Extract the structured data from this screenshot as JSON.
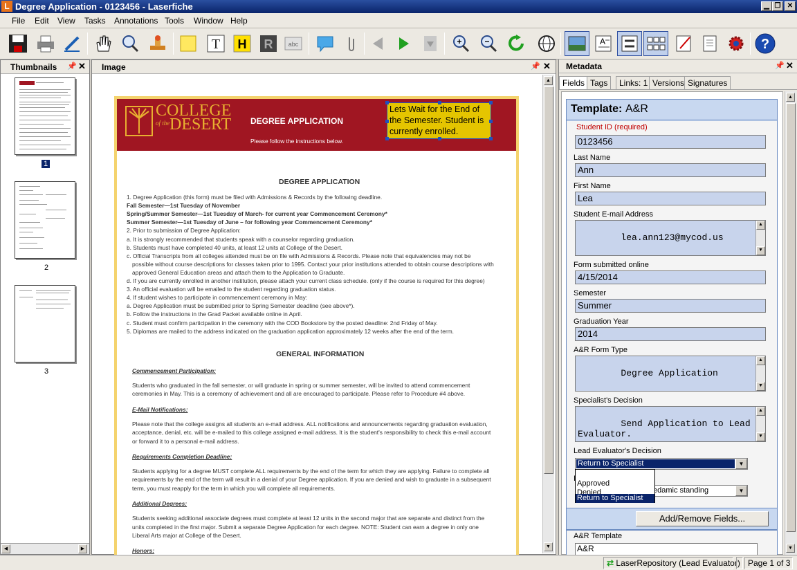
{
  "window": {
    "title": "Degree Application - 0123456 - Laserfiche",
    "app_icon_letter": "L"
  },
  "menu": [
    "File",
    "Edit",
    "View",
    "Tasks",
    "Annotations",
    "Tools",
    "Window",
    "Help"
  ],
  "toolbar": {
    "icons": [
      "save-icon",
      "print-icon",
      "pen-icon",
      "hand-icon",
      "zoom-select-icon",
      "stamp-icon",
      "sticky-note-icon",
      "text-icon",
      "highlight-icon",
      "redact-icon",
      "ocr-text-icon",
      "comment-icon",
      "attachment-icon",
      "previous-page-icon",
      "next-page-icon",
      "page-down-icon",
      "zoom-in-icon",
      "zoom-out-icon",
      "refresh-icon",
      "globe-icon",
      "image-view-icon",
      "text-view-icon",
      "metadata-view-icon",
      "thumbnail-view-icon",
      "edit-document-icon",
      "document-icon",
      "settings-icon",
      "help-icon"
    ],
    "text_tool_glyph": "T",
    "highlight_glyph": "H",
    "redact_glyph": "R",
    "ocr_glyph": "abc"
  },
  "thumbnails": {
    "title": "Thumbnails",
    "pages": [
      "1",
      "2",
      "3"
    ],
    "selected": "1"
  },
  "image_pane": {
    "title": "Image"
  },
  "document": {
    "college_name_line1": "COLLEGE",
    "college_name_line2": "of the",
    "college_name_line3": "DESERT",
    "header_title": "DEGREE APPLICATION",
    "header_subtitle": "Please follow the instructions below.",
    "heading1": "DEGREE APPLICATION",
    "items": [
      "1. Degree Application (this form) must be filed with Admissions & Records by the following deadline.",
      "Fall Semester—1st Tuesday of November",
      "Spring/Summer Semester—1st Tuesday of March- for current year Commencement Ceremony*",
      "Summer Semester—1st Tuesday of June – for following year Commencement Ceremony*",
      "2. Prior to submission of Degree Application:",
      "a. It is strongly recommended that students speak with a counselor regarding graduation.",
      "b. Students must have completed 40 units, at least 12 units at College of the Desert.",
      "c. Official Transcripts from all colleges attended must be on file with Admissions & Records. Please note that equivalencies may not be",
      "possible without course descriptions for classes taken prior to 1995. Contact your prior institutions attended to obtain course descriptions with",
      "approved General Education areas and attach them to the Application to Graduate.",
      "d. If you are currently enrolled in another institution, please attach your current class schedule. (only if the course is required for this degree)",
      "3. An official evaluation will be emailed to the student regarding graduation status.",
      "4. If student wishes to participate in commencement ceremony in May:",
      "a. Degree Application must be submitted prior to Spring Semester deadline (see above*).",
      "b. Follow the instructions in the Grad Packet available online in April.",
      "c. Student must confirm participation in the ceremony with the COD Bookstore by the posted deadline: 2nd Friday of May.",
      "5. Diplomas are mailed to the address indicated on the graduation application approximately 12 weeks after the end of the term."
    ],
    "heading2": "GENERAL INFORMATION",
    "sections": [
      {
        "title": "Commencement Participation:",
        "lines": [
          "Students who graduated in the fall semester, or will graduate in spring or summer semester, will be invited to attend commencement",
          "ceremonies in May. This is a ceremony of achievement and all are encouraged to participate. Please refer to Procedure #4 above."
        ]
      },
      {
        "title": "E-Mail Notifications:",
        "lines": [
          "Please note that the college assigns all students an e-mail address. ALL notifications and announcements regarding graduation evaluation,",
          "acceptance, denial, etc. will be e-mailed to this college assigned e-mail address. It is the student's responsibility to check this e-mail account",
          "or forward it to a personal e-mail address."
        ]
      },
      {
        "title": "Requirements Completion Deadline:",
        "lines": [
          "Students applying for a degree MUST complete ALL requirements by the end of the term for which they are applying. Failure to complete all",
          "requirements by the end of the term will result in a denial of your Degree application. If you are denied and wish to graduate in a subsequent",
          "term, you must reapply for the term in which you will complete all requirements."
        ]
      },
      {
        "title": "Additional Degrees:",
        "lines": [
          "Students seeking additional associate degrees must complete at least 12 units in the second major that are separate and distinct from the",
          "units completed in the first major. Submit a separate Degree Application for each degree. NOTE: Student can earn a degree in only one",
          "Liberal Arts major at College of the Desert."
        ]
      },
      {
        "title": "Honors:",
        "lines": []
      }
    ],
    "annotation": "Lets Wait for the End of the Semester. Student is currently enrolled."
  },
  "metadata": {
    "title": "Metadata",
    "tabs": [
      "Fields",
      "Tags",
      "Links: 1",
      "Versions",
      "Signatures"
    ],
    "template_label": "Template:",
    "template_name": "A&R",
    "fields": {
      "student_id_label": "Student ID (required)",
      "student_id": "0123456",
      "last_name_label": "Last Name",
      "last_name": "Ann",
      "first_name_label": "First Name",
      "first_name": "Lea",
      "email_label": "Student E-mail Address",
      "email": "lea.ann123@mycod.us",
      "submitted_label": "Form submitted online",
      "submitted": "4/15/2014",
      "semester_label": "Semester",
      "semester": "Summer",
      "grad_year_label": "Graduation Year",
      "grad_year": "2014",
      "form_type_label": "A&R Form Type",
      "form_type": "Degree Application",
      "specialist_label": "Specialist's Decision",
      "specialist": "Send Application to Lead Evaluator.",
      "lead_label": "Lead Evaluator's Decision",
      "lead": "Return to Specialist",
      "lead_options": [
        "Approved",
        "Denied",
        "Return to Specialist"
      ],
      "hidden_label_initial": "I",
      "hidden_select_value": "edamic standing"
    },
    "add_remove_label": "Add/Remove Fields...",
    "bottom_template_label": "A&R Template",
    "bottom_template_value": "A&R"
  },
  "status": {
    "repository": "LaserRepository (Lead Evaluator)",
    "page": "Page 1 of 3"
  },
  "colors": {
    "header_red": "#a01622",
    "annotation_yellow": "#e5c500",
    "field_blue": "#c8d8f0",
    "selection_navy": "#0a246a"
  }
}
